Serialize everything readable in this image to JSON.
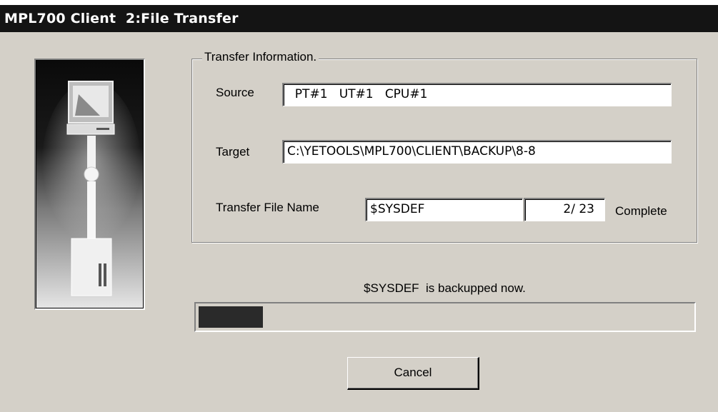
{
  "window": {
    "title": "MPL700 Client  2:File Transfer"
  },
  "group": {
    "legend": "Transfer Information."
  },
  "source": {
    "label": "Source",
    "value": "  PT#1   UT#1   CPU#1"
  },
  "target": {
    "label": "Target",
    "value": "C:\\YETOOLS\\MPL700\\CLIENT\\BACKUP\\8-8"
  },
  "transfer": {
    "label": "Transfer File Name",
    "file_name": "$SYSDEF",
    "count": "2/ 23",
    "complete_label": "Complete"
  },
  "status": {
    "message": "$SYSDEF  is backupped now.",
    "progress_fraction": 0.13
  },
  "buttons": {
    "cancel_label": "Cancel"
  }
}
